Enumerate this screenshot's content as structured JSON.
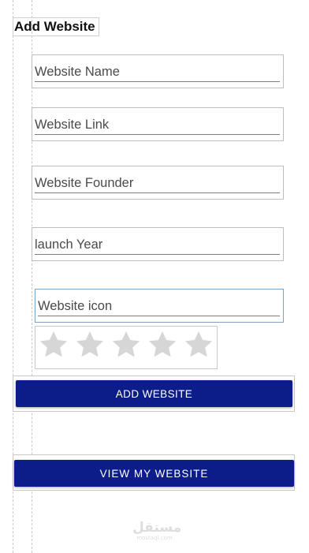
{
  "page": {
    "title": "Add Website"
  },
  "form": {
    "fields": [
      {
        "label": "Website Name"
      },
      {
        "label": "Website Link"
      },
      {
        "label": "Website Founder"
      },
      {
        "label": "launch Year"
      },
      {
        "label": "Website icon"
      }
    ],
    "rating": {
      "max": 5,
      "value": 0,
      "icon": "star-icon",
      "empty_color": "#d6d6d6"
    }
  },
  "buttons": {
    "add_website": "ADD WEBSITE",
    "view_my_website": "VIEW MY WEBSITE"
  },
  "colors": {
    "primary": "#0c1d8a",
    "text": "#4a4a4a"
  },
  "watermark": {
    "main": "مستقل",
    "sub": "mostaql.com"
  }
}
